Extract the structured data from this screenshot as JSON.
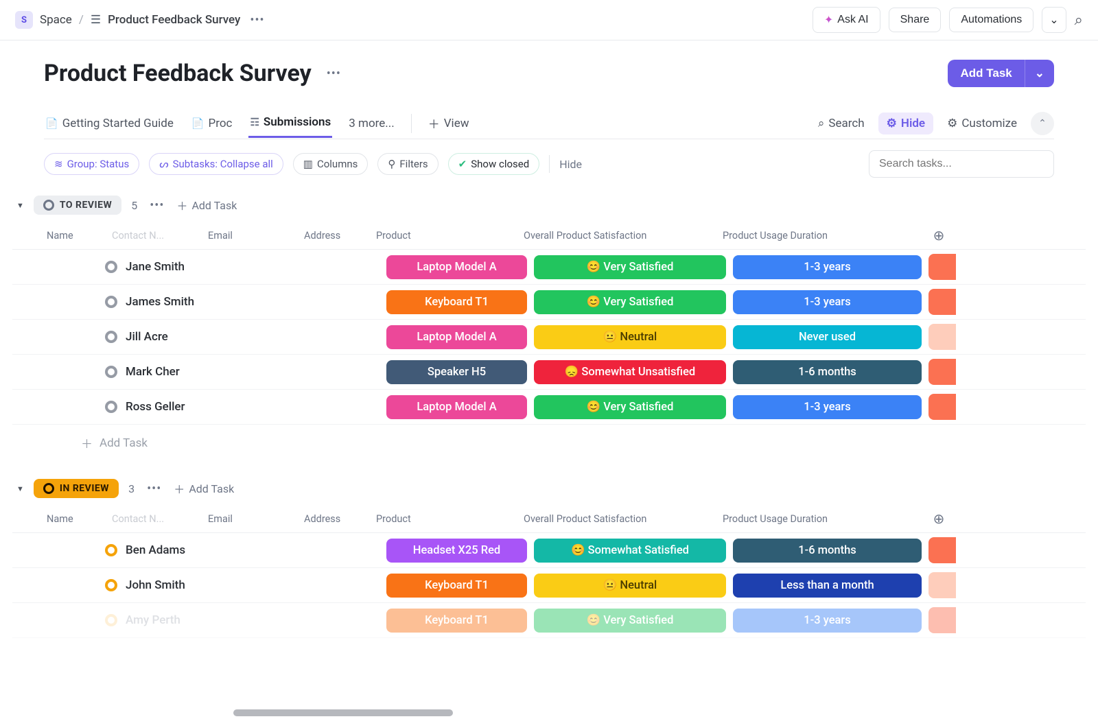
{
  "crumbs": {
    "space_letter": "S",
    "space": "Space",
    "page": "Product Feedback Survey"
  },
  "topbar": {
    "ask_ai": "Ask AI",
    "share": "Share",
    "automations": "Automations"
  },
  "page_title": "Product Feedback Survey",
  "add_task_btn": "Add Task",
  "tabs": {
    "guide": "Getting Started Guide",
    "proc": "Proc",
    "submissions": "Submissions",
    "more": "3 more...",
    "view": "View"
  },
  "tools": {
    "search": "Search",
    "hide": "Hide",
    "customize": "Customize"
  },
  "filters": {
    "group": "Group: Status",
    "subtasks": "Subtasks: Collapse all",
    "columns": "Columns",
    "filters": "Filters",
    "show_closed": "Show closed",
    "hide": "Hide",
    "search_placeholder": "Search tasks..."
  },
  "columns": {
    "name": "Name",
    "contact": "Contact N...",
    "email": "Email",
    "address": "Address",
    "product": "Product",
    "satisfaction": "Overall Product Satisfaction",
    "duration": "Product Usage Duration"
  },
  "groups": [
    {
      "id": "to_review",
      "label": "TO REVIEW",
      "count": "5",
      "add": "Add Task",
      "status_style": "todo",
      "rows": [
        {
          "name": "Jane Smith",
          "product": "Laptop Model A",
          "product_c": "pink",
          "sat": "😊 Very Satisfied",
          "sat_c": "green",
          "dur": "1-3 years",
          "dur_c": "blue",
          "sliver": "sliver"
        },
        {
          "name": "James Smith",
          "product": "Keyboard T1",
          "product_c": "orange",
          "sat": "😊 Very Satisfied",
          "sat_c": "green",
          "dur": "1-3 years",
          "dur_c": "blue",
          "sliver": "sliver"
        },
        {
          "name": "Jill Acre",
          "product": "Laptop Model A",
          "product_c": "pink",
          "sat": "😐 Neutral",
          "sat_c": "yellow",
          "dur": "Never used",
          "dur_c": "cyan",
          "sliver": "sliver peach"
        },
        {
          "name": "Mark Cher",
          "product": "Speaker H5",
          "product_c": "steel",
          "sat": "😞 Somewhat Unsatisfied",
          "sat_c": "red",
          "dur": "1-6 months",
          "dur_c": "steel2",
          "sliver": "sliver"
        },
        {
          "name": "Ross Geller",
          "product": "Laptop Model A",
          "product_c": "pink",
          "sat": "😊 Very Satisfied",
          "sat_c": "green",
          "dur": "1-3 years",
          "dur_c": "blue",
          "sliver": "sliver"
        }
      ],
      "add_row": "Add Task"
    },
    {
      "id": "in_review",
      "label": "IN REVIEW",
      "count": "3",
      "add": "Add Task",
      "status_style": "review",
      "rows": [
        {
          "name": "Ben Adams",
          "product": "Headset X25 Red",
          "product_c": "purple",
          "sat": "😊 Somewhat Satisfied",
          "sat_c": "teal",
          "dur": "1-6 months",
          "dur_c": "steel2",
          "sliver": "sliver",
          "circle": "orange"
        },
        {
          "name": "John Smith",
          "product": "Keyboard T1",
          "product_c": "orange",
          "sat": "😐 Neutral",
          "sat_c": "yellow",
          "dur": "Less than a month",
          "dur_c": "bluedeep",
          "sliver": "sliver peach",
          "circle": "orange"
        },
        {
          "name": "Amy Perth",
          "product": "Keyboard T1",
          "product_c": "orange",
          "sat": "😊 Very Satisfied",
          "sat_c": "green",
          "dur": "1-3 years",
          "dur_c": "blue",
          "sliver": "sliver",
          "circle": "orange",
          "faded": true
        }
      ]
    }
  ]
}
